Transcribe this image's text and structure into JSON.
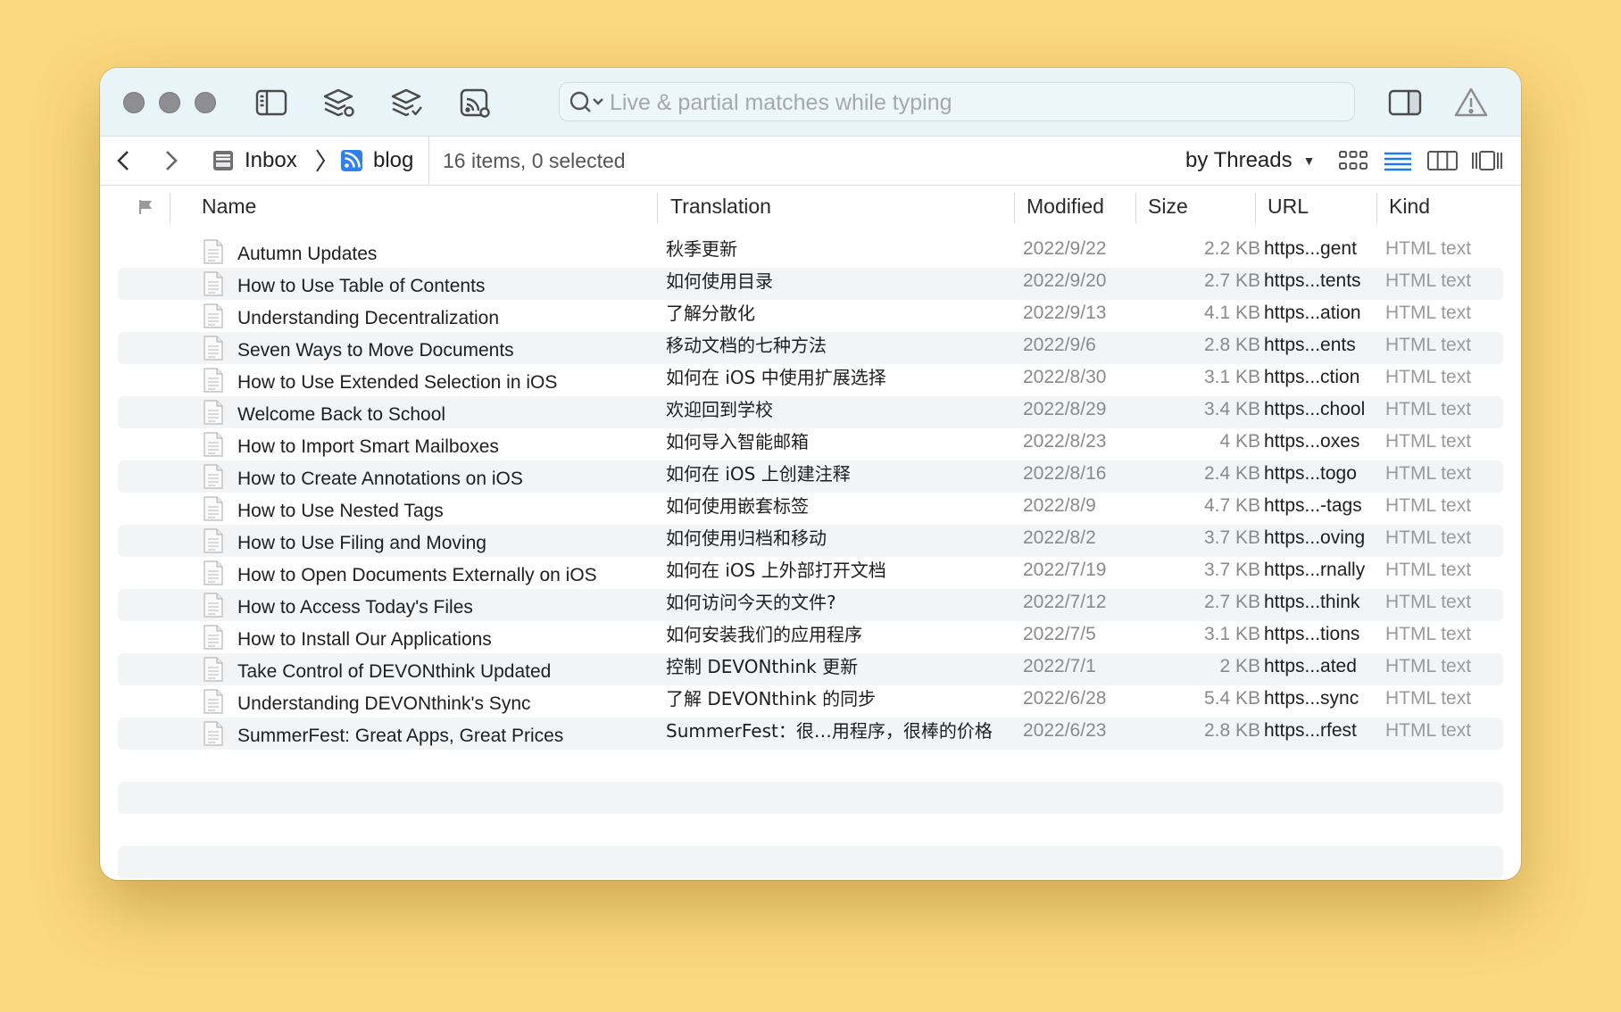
{
  "search": {
    "placeholder": "Live & partial matches while typing"
  },
  "path": {
    "inbox_label": "Inbox",
    "blog_label": "blog",
    "status": "16 items, 0 selected"
  },
  "sort": {
    "label": "by Threads"
  },
  "columns": {
    "name": "Name",
    "translation": "Translation",
    "modified": "Modified",
    "size": "Size",
    "url": "URL",
    "kind": "Kind"
  },
  "items": [
    {
      "name": "Autumn Updates",
      "translation": "秋季更新",
      "modified": "2022/9/22",
      "size": "2.2 KB",
      "url": "https...gent",
      "kind": "HTML text"
    },
    {
      "name": "How to Use Table of Contents",
      "translation": "如何使用目录",
      "modified": "2022/9/20",
      "size": "2.7 KB",
      "url": "https...tents",
      "kind": "HTML text"
    },
    {
      "name": "Understanding Decentralization",
      "translation": "了解分散化",
      "modified": "2022/9/13",
      "size": "4.1 KB",
      "url": "https...ation",
      "kind": "HTML text"
    },
    {
      "name": "Seven Ways to Move Documents",
      "translation": "移动文档的七种方法",
      "modified": "2022/9/6",
      "size": "2.8 KB",
      "url": "https...ents",
      "kind": "HTML text"
    },
    {
      "name": "How to Use Extended Selection in iOS",
      "translation": "如何在 iOS 中使用扩展选择",
      "modified": "2022/8/30",
      "size": "3.1 KB",
      "url": "https...ction",
      "kind": "HTML text"
    },
    {
      "name": "Welcome Back to School",
      "translation": "欢迎回到学校",
      "modified": "2022/8/29",
      "size": "3.4 KB",
      "url": "https...chool",
      "kind": "HTML text"
    },
    {
      "name": "How to Import Smart Mailboxes",
      "translation": "如何导入智能邮箱",
      "modified": "2022/8/23",
      "size": "4 KB",
      "url": "https...oxes",
      "kind": "HTML text"
    },
    {
      "name": "How to Create Annotations on iOS",
      "translation": "如何在 iOS 上创建注释",
      "modified": "2022/8/16",
      "size": "2.4 KB",
      "url": "https...togo",
      "kind": "HTML text"
    },
    {
      "name": "How to Use Nested Tags",
      "translation": "如何使用嵌套标签",
      "modified": "2022/8/9",
      "size": "4.7 KB",
      "url": "https...-tags",
      "kind": "HTML text"
    },
    {
      "name": "How to Use Filing and Moving",
      "translation": "如何使用归档和移动",
      "modified": "2022/8/2",
      "size": "3.7 KB",
      "url": "https...oving",
      "kind": "HTML text"
    },
    {
      "name": "How to Open Documents Externally on iOS",
      "translation": "如何在 iOS 上外部打开文档",
      "modified": "2022/7/19",
      "size": "3.7 KB",
      "url": "https...rnally",
      "kind": "HTML text"
    },
    {
      "name": "How to Access Today's Files",
      "translation": "如何访问今天的文件?",
      "modified": "2022/7/12",
      "size": "2.7 KB",
      "url": "https...think",
      "kind": "HTML text"
    },
    {
      "name": "How to Install Our Applications",
      "translation": "如何安装我们的应用程序",
      "modified": "2022/7/5",
      "size": "3.1 KB",
      "url": "https...tions",
      "kind": "HTML text"
    },
    {
      "name": "Take Control of DEVONthink Updated",
      "translation": "控制 DEVONthink 更新",
      "modified": "2022/7/1",
      "size": "2 KB",
      "url": "https...ated",
      "kind": "HTML text"
    },
    {
      "name": "Understanding DEVONthink's Sync",
      "translation": "了解 DEVONthink 的同步",
      "modified": "2022/6/28",
      "size": "5.4 KB",
      "url": "https...sync",
      "kind": "HTML text"
    },
    {
      "name": "SummerFest: Great Apps, Great Prices",
      "translation": "SummerFest：很…用程序，很棒的价格",
      "modified": "2022/6/23",
      "size": "2.8 KB",
      "url": "https...rfest",
      "kind": "HTML text"
    }
  ]
}
